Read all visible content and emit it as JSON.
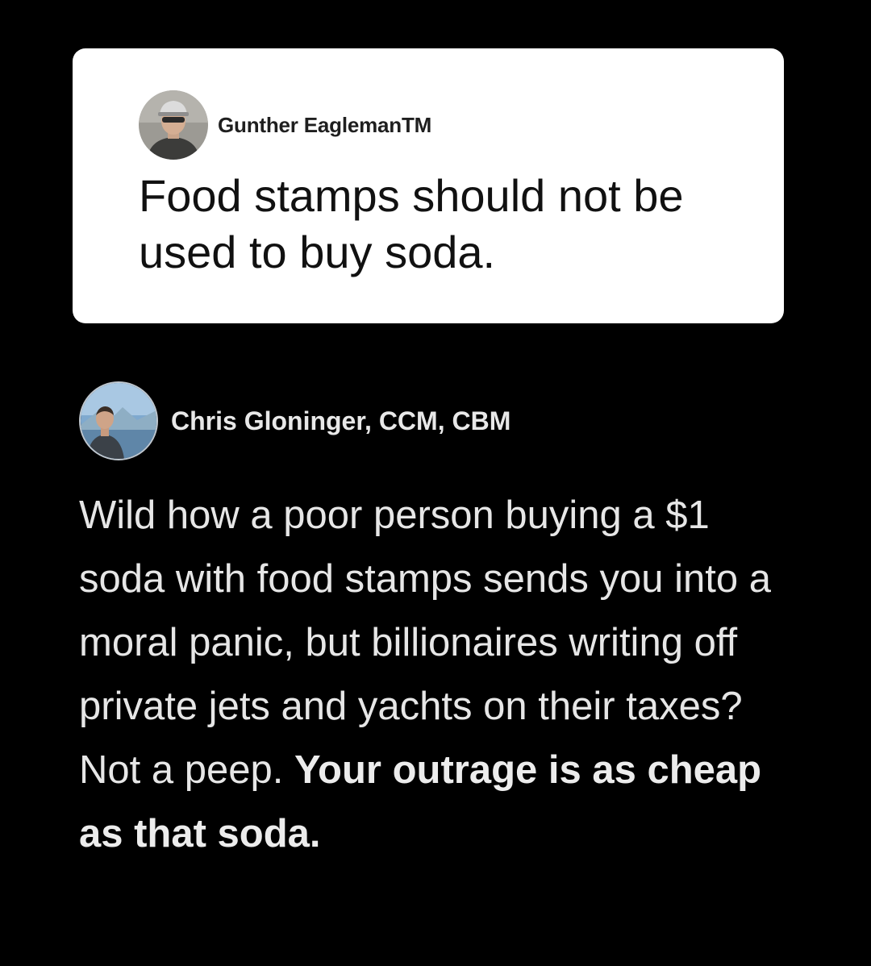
{
  "post": {
    "author": "Gunther EaglemanTM",
    "avatar_icon": "user-avatar-photo",
    "text": "Food stamps should not be used to buy soda."
  },
  "reply": {
    "author": "Chris Gloninger, CCM, CBM",
    "avatar_icon": "user-avatar-photo",
    "text": "Wild how a poor person buying a $1 soda with food stamps sends you into a moral panic, but billionaires writing off private jets and yachts on their taxes? Not a peep.",
    "emphasis": "Your outrage is as cheap as that soda."
  },
  "colors": {
    "background": "#000000",
    "card": "#ffffff",
    "reply_text": "#e6e6e6"
  }
}
